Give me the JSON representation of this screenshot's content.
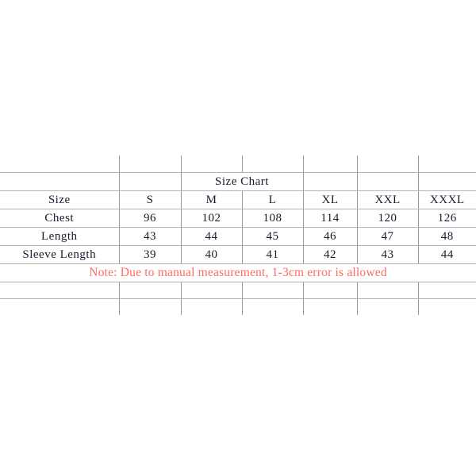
{
  "chart_data": {
    "type": "table",
    "title": "Size Chart",
    "columns": [
      "Size",
      "S",
      "M",
      "L",
      "XL",
      "XXL",
      "XXXL"
    ],
    "rows": [
      {
        "label": "Chest",
        "values": [
          "96",
          "102",
          "108",
          "114",
          "120",
          "126"
        ]
      },
      {
        "label": "Length",
        "values": [
          "43",
          "44",
          "45",
          "46",
          "47",
          "48"
        ]
      },
      {
        "label": "Sleeve Length",
        "values": [
          "39",
          "40",
          "41",
          "42",
          "43",
          "44"
        ]
      }
    ],
    "note": "Note: Due to manual measurement, 1-3cm error is allowed",
    "note_color": "#fa6e64",
    "text_color": "#1a1a2e",
    "grid_color": "#9a9a9a",
    "background": "#ffffff"
  },
  "table": {
    "title": "Size Chart",
    "header": {
      "label": "Size",
      "sizes": [
        "S",
        "M",
        "L",
        "XL",
        "XXL",
        "XXXL"
      ]
    },
    "measurements": [
      {
        "label": "Chest",
        "s": "96",
        "m": "102",
        "l": "108",
        "xl": "114",
        "xxl": "120",
        "xxxl": "126"
      },
      {
        "label": "Length",
        "s": "43",
        "m": "44",
        "l": "45",
        "xl": "46",
        "xxl": "47",
        "xxxl": "48"
      },
      {
        "label": "Sleeve Length",
        "s": "39",
        "m": "40",
        "l": "41",
        "xl": "42",
        "xxl": "43",
        "xxxl": "44"
      }
    ],
    "note": "Note: Due to manual measurement, 1-3cm error is allowed",
    "empty": ""
  }
}
